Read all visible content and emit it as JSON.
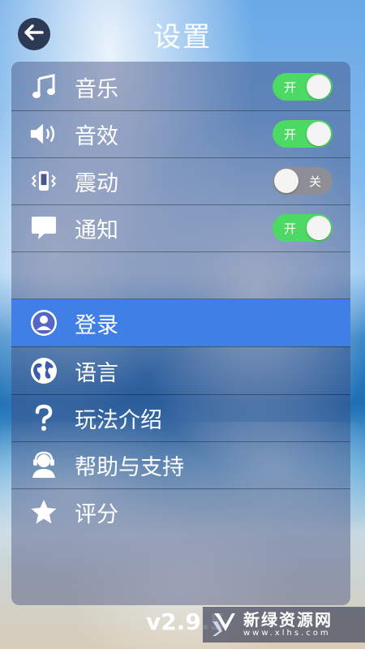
{
  "header": {
    "title": "设置"
  },
  "toggles": [
    {
      "label": "音乐",
      "state": "开",
      "on": true,
      "icon": "music-icon"
    },
    {
      "label": "音效",
      "state": "开",
      "on": true,
      "icon": "speaker-icon"
    },
    {
      "label": "震动",
      "state": "关",
      "on": false,
      "icon": "vibrate-icon"
    },
    {
      "label": "通知",
      "state": "开",
      "on": true,
      "icon": "notification-icon"
    }
  ],
  "menu": [
    {
      "label": "登录",
      "icon": "user-icon",
      "selected": true
    },
    {
      "label": "语言",
      "icon": "globe-icon"
    },
    {
      "label": "玩法介绍",
      "icon": "question-icon"
    },
    {
      "label": "帮助与支持",
      "icon": "support-icon"
    },
    {
      "label": "评分",
      "icon": "star-icon"
    }
  ],
  "version": "v2.9.5",
  "watermark": {
    "main": "新绿资源网",
    "sub": "www.xlhs.com"
  },
  "colors": {
    "selected": "#3f7fe6",
    "toggle_on": "#4cd964",
    "toggle_off": "#8e8e96"
  }
}
